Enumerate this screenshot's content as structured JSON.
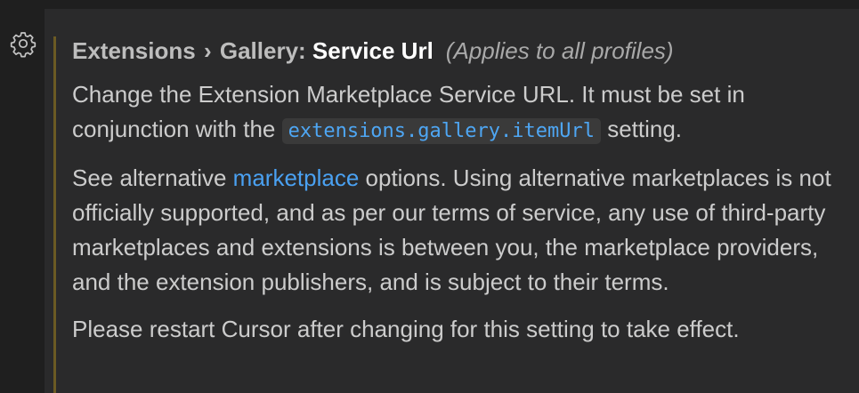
{
  "icons": {
    "gear": "gear-icon"
  },
  "colors": {
    "background": "#1f1f1f",
    "panel": "#2a2a2b",
    "modified_indicator": "#6b5a23",
    "link": "#4aa1f2",
    "code_text": "#4ea6f3"
  },
  "setting": {
    "category": "Extensions",
    "separator": "›",
    "subcategory": "Gallery:",
    "name": "Service Url",
    "scope": "(Applies to all profiles)",
    "description": {
      "p1_before": "Change the Extension Marketplace Service URL. It must be set in conjunction with the ",
      "p1_code": "extensions.gallery.itemUrl",
      "p1_after": " setting.",
      "p2_before": "See alternative ",
      "p2_link": "marketplace",
      "p2_after": " options. Using alternative marketplaces is not officially supported, and as per our terms of service, any use of third-party marketplaces and extensions is between you, the marketplace providers, and the extension publishers, and is subject to their terms.",
      "p3": "Please restart Cursor after changing for this setting to take effect."
    }
  }
}
